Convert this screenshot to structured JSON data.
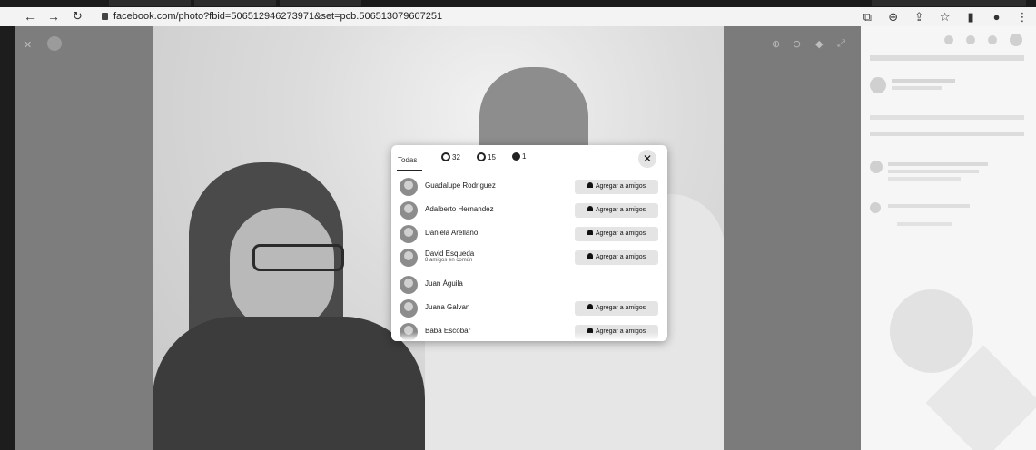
{
  "browser": {
    "url": "facebook.com/photo?fbid=506512946273971&set=pcb.506513079607251",
    "icons": [
      "screenshot-icon",
      "zoom-icon",
      "share-icon",
      "star-icon",
      "sidebar-icon",
      "profile-icon",
      "menu-icon"
    ]
  },
  "reactions_dialog": {
    "tabs": [
      {
        "label": "Todas"
      },
      {
        "icon": "like-icon",
        "count": "32"
      },
      {
        "icon": "love-icon",
        "count": "15"
      },
      {
        "icon": "care-icon",
        "count": "1"
      }
    ],
    "close_label": "✕",
    "people": [
      {
        "name": "Guadalupe Rodriguez",
        "subtitle": "",
        "button": "Agregar a amigos"
      },
      {
        "name": "Adalberto Hernandez",
        "subtitle": "",
        "button": "Agregar a amigos"
      },
      {
        "name": "Daniela Arellano",
        "subtitle": "",
        "button": "Agregar a amigos"
      },
      {
        "name": "David Esqueda",
        "subtitle": "8 amigos en común",
        "button": "Agregar a amigos"
      },
      {
        "name": "Juan Águila",
        "subtitle": "",
        "button": ""
      },
      {
        "name": "Juana Galvan",
        "subtitle": "",
        "button": "Agregar a amigos"
      },
      {
        "name": "Baba Escobar",
        "subtitle": "",
        "button": "Agregar a amigos"
      }
    ]
  }
}
